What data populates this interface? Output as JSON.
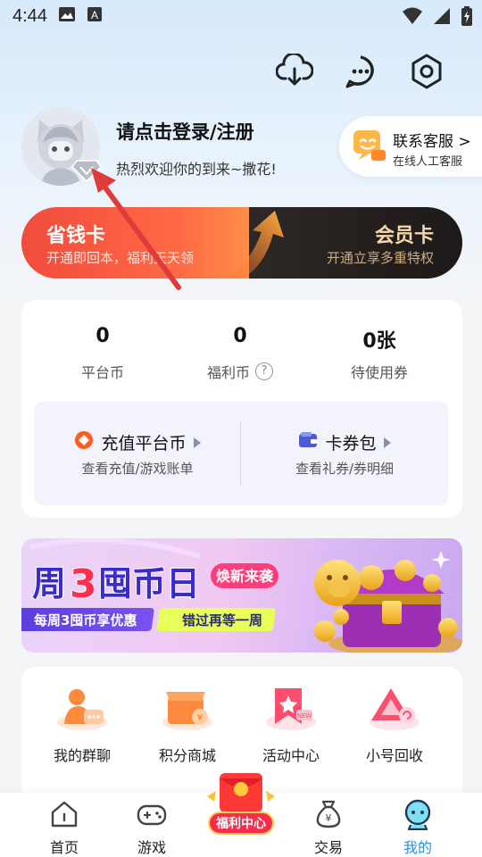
{
  "status_bar": {
    "time": "4:44"
  },
  "header": {
    "login_title": "请点击登录/注册",
    "welcome_text": "热烈欢迎你的到来~撒花!"
  },
  "top_actions": [
    "download-cloud-icon",
    "message-icon",
    "settings-icon"
  ],
  "customer_service": {
    "title": "联系客服 >",
    "subtitle": "在线人工客服"
  },
  "cards": {
    "saver": {
      "title": "省钱卡",
      "subtitle": "开通即回本，福利天天领"
    },
    "member": {
      "title": "会员卡",
      "subtitle": "开通立享多重特权"
    }
  },
  "wallet": {
    "stats": [
      {
        "value": "0",
        "label": "平台币"
      },
      {
        "value": "0",
        "label": "福利币"
      },
      {
        "value": "0张",
        "label": "待使用券"
      }
    ],
    "help": "?",
    "recharge": {
      "title": "充值平台币",
      "subtitle": "查看充值/游戏账单"
    },
    "coupons": {
      "title": "卡券包",
      "subtitle": "查看礼券/券明细"
    }
  },
  "banner": {
    "title_a": "周",
    "title_num": "3",
    "title_b": "囤币日",
    "tag": "焕新来袭",
    "sub_a": "每周3囤币享优惠",
    "sub_b": "错过再等一周"
  },
  "grid": [
    {
      "label": "我的群聊",
      "icon": "group-chat-icon"
    },
    {
      "label": "积分商城",
      "icon": "points-mall-icon"
    },
    {
      "label": "活动中心",
      "icon": "activity-center-icon"
    },
    {
      "label": "小号回收",
      "icon": "account-recycle-icon"
    }
  ],
  "bottom_nav": [
    {
      "label": "首页",
      "icon": "home-icon"
    },
    {
      "label": "游戏",
      "icon": "gamepad-icon"
    },
    {
      "label": "交易",
      "icon": "money-bag-icon"
    },
    {
      "label": "我的",
      "icon": "profile-icon"
    }
  ],
  "welfare": {
    "label": "福利中心"
  },
  "colors": {
    "accent_blue": "#2b8ff0",
    "saver_red": "#f24b3c",
    "member_gold": "#f5d7a9",
    "arrow_red": "#e03b3b"
  }
}
